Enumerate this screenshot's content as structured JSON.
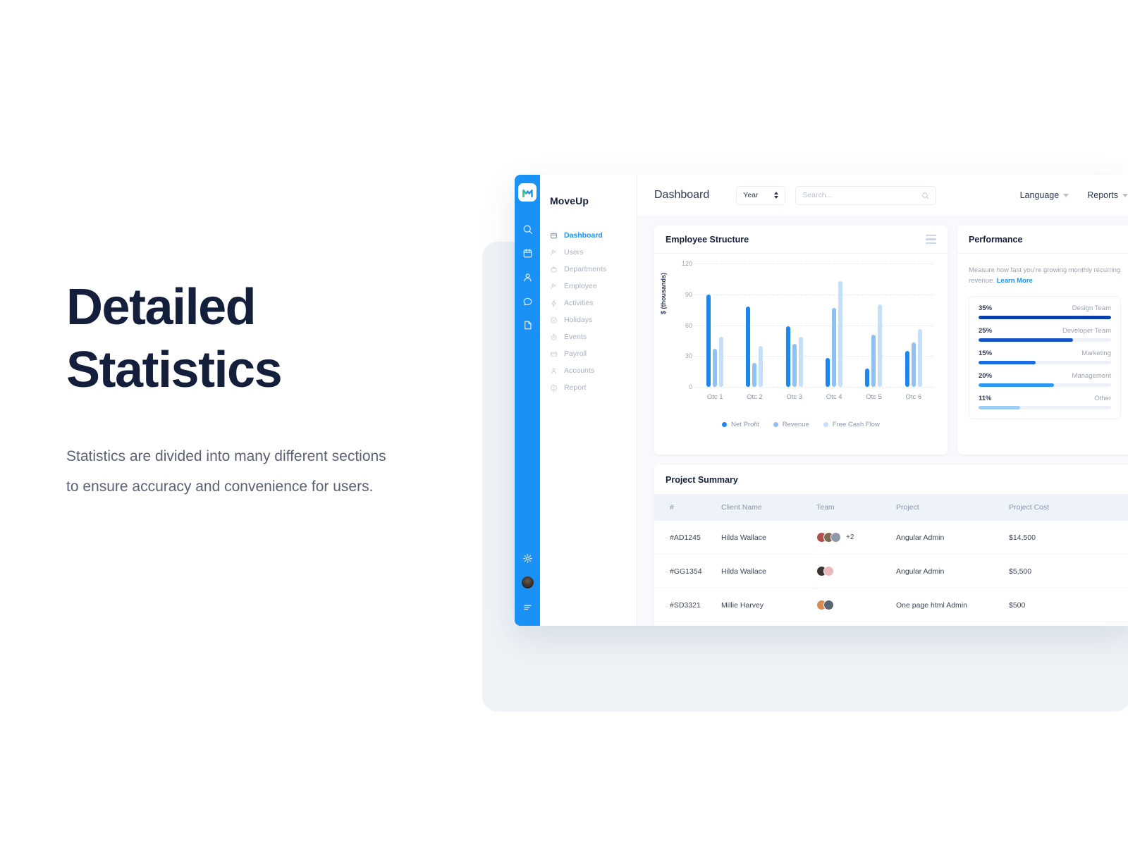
{
  "marketing": {
    "headline_line1": "Detailed",
    "headline_line2": "Statistics",
    "subcopy": "Statistics are divided into many different sections to ensure accuracy and convenience for users."
  },
  "app": {
    "brand": "MoveUp",
    "rail_icons": [
      "search-icon",
      "calendar-icon",
      "user-icon",
      "chat-icon",
      "document-icon"
    ],
    "rail_bottom_icons": [
      "gear-icon",
      "avatar",
      "menu-icon"
    ],
    "sidebar": {
      "items": [
        {
          "label": "Dashboard",
          "icon": "dashboard-icon",
          "active": true
        },
        {
          "label": "Users",
          "icon": "users-icon",
          "active": false
        },
        {
          "label": "Departments",
          "icon": "briefcase-icon",
          "active": false
        },
        {
          "label": "Employee",
          "icon": "users-icon",
          "active": false
        },
        {
          "label": "Activities",
          "icon": "bolt-icon",
          "active": false
        },
        {
          "label": "Holidays",
          "icon": "check-circle-icon",
          "active": false
        },
        {
          "label": "Events",
          "icon": "clock-icon",
          "active": false
        },
        {
          "label": "Payroll",
          "icon": "card-icon",
          "active": false
        },
        {
          "label": "Accounts",
          "icon": "user-icon",
          "active": false
        },
        {
          "label": "Report",
          "icon": "info-circle-icon",
          "active": false
        }
      ]
    },
    "topbar": {
      "page_title": "Dashboard",
      "period_value": "Year",
      "search_placeholder": "Search...",
      "search_value": "",
      "nav": [
        {
          "label": "Language"
        },
        {
          "label": "Reports"
        }
      ]
    }
  },
  "chart_data": {
    "type": "bar",
    "title": "Employee Structure",
    "xlabel": "",
    "ylabel": "$ (thousands)",
    "ylim": [
      0,
      120
    ],
    "yticks": [
      0,
      30,
      60,
      90,
      120
    ],
    "grid": true,
    "legend_position": "bottom",
    "categories": [
      "Otc 1",
      "Otc 2",
      "Otc 3",
      "Otc 4",
      "Otc 5",
      "Otc 6"
    ],
    "series": [
      {
        "name": "Net Profit",
        "color": "#1a86f0",
        "values": [
          90,
          78,
          59,
          28,
          18,
          35
        ]
      },
      {
        "name": "Revenue",
        "color": "#8fc1f3",
        "values": [
          37,
          23,
          42,
          77,
          51,
          43
        ]
      },
      {
        "name": "Free Cash Flow",
        "color": "#c5dffa",
        "values": [
          49,
          40,
          49,
          103,
          80,
          56
        ]
      }
    ]
  },
  "performance": {
    "title": "Performance",
    "description_text": "Measure how fast you're growing monthly recurring revenue. ",
    "description_link": "Learn More",
    "rows": [
      {
        "pct": "35%",
        "value": 35,
        "name": "Design Team",
        "color": "#0b3fa8"
      },
      {
        "pct": "25%",
        "value": 25,
        "name": "Developer Team",
        "color": "#1455c7"
      },
      {
        "pct": "15%",
        "value": 15,
        "name": "Marketing",
        "color": "#1b6ce0"
      },
      {
        "pct": "20%",
        "value": 20,
        "name": "Management",
        "color": "#2a9af6"
      },
      {
        "pct": "11%",
        "value": 11,
        "name": "Other",
        "color": "#9ccdf7"
      }
    ]
  },
  "project_summary": {
    "title": "Project Summary",
    "columns": [
      "#",
      "Client Name",
      "Team",
      "Project",
      "Project Cost"
    ],
    "rows": [
      {
        "id": "#AD1245",
        "client": "Hilda Wallace",
        "avatars": [
          "#b0514a",
          "#7d6a53",
          "#8f98a8"
        ],
        "extra": "+2",
        "project": "Angular Admin",
        "cost": "$14,500"
      },
      {
        "id": "#GG1354",
        "client": "Hilda Wallace",
        "avatars": [
          "#3b3431",
          "#e8b9bf"
        ],
        "extra": "",
        "project": "Angular Admin",
        "cost": "$5,500"
      },
      {
        "id": "#SD3321",
        "client": "Millie Harvey",
        "avatars": [
          "#d88b4e",
          "#5a6472"
        ],
        "extra": "",
        "project": "One page html Admin",
        "cost": "$500"
      }
    ]
  },
  "colors": {
    "accent": "#1a92f5",
    "headline": "#141f3c",
    "backdrop": "#eef3f7",
    "content_bg": "#f7f9fc"
  }
}
